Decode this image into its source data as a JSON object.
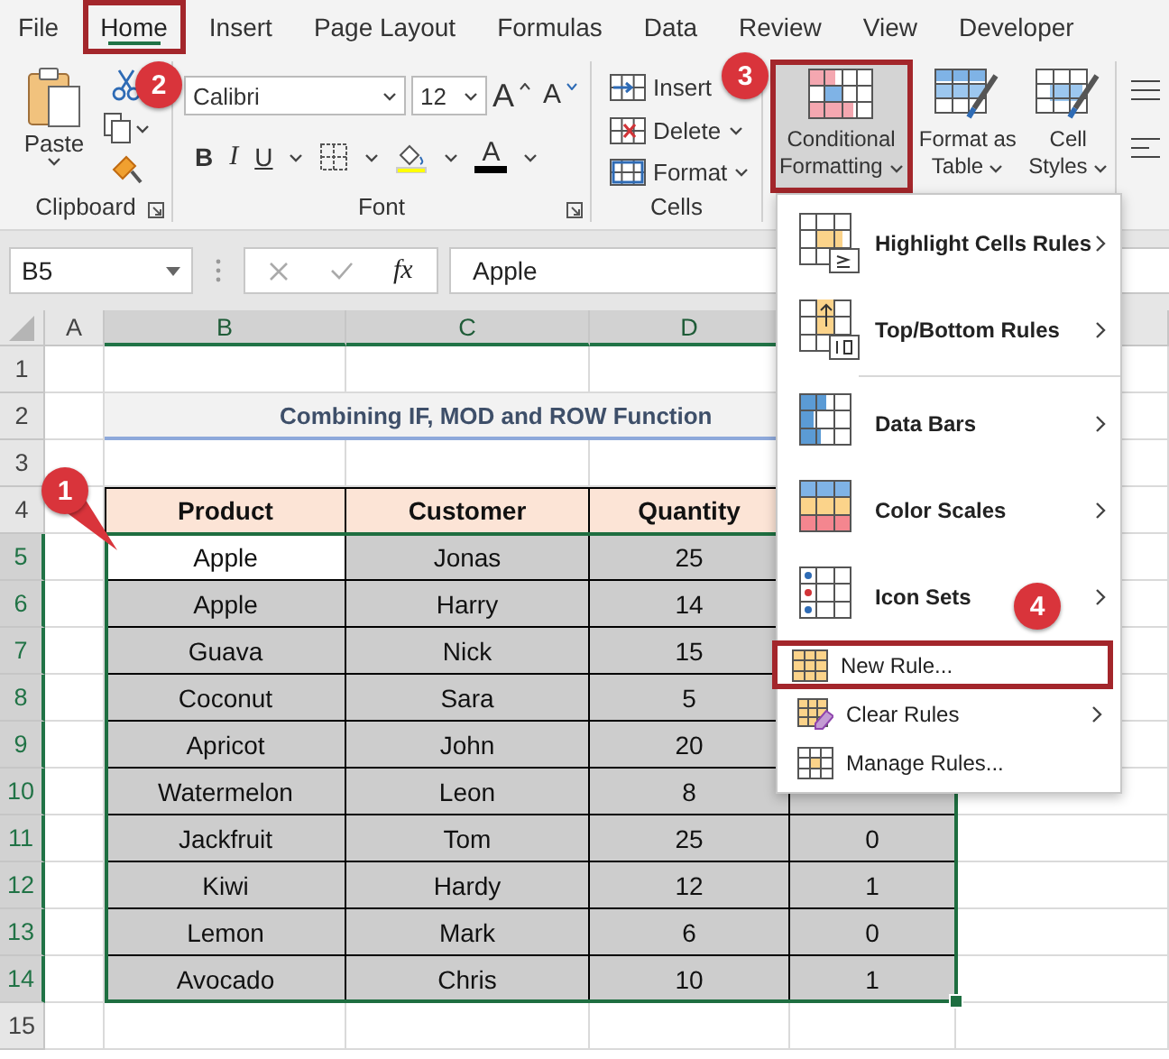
{
  "tabs": [
    {
      "label": "File",
      "selected": false,
      "highlighted": false
    },
    {
      "label": "Home",
      "selected": true,
      "highlighted": true
    },
    {
      "label": "Insert",
      "selected": false,
      "highlighted": false
    },
    {
      "label": "Page Layout",
      "selected": false,
      "highlighted": false
    },
    {
      "label": "Formulas",
      "selected": false,
      "highlighted": false
    },
    {
      "label": "Data",
      "selected": false,
      "highlighted": false
    },
    {
      "label": "Review",
      "selected": false,
      "highlighted": false
    },
    {
      "label": "View",
      "selected": false,
      "highlighted": false
    },
    {
      "label": "Developer",
      "selected": false,
      "highlighted": false
    }
  ],
  "ribbon": {
    "clipboard": {
      "paste_label": "Paste",
      "group_label": "Clipboard"
    },
    "font": {
      "font_name": "Calibri",
      "font_size": "12",
      "grow_label": "A",
      "shrink_label": "A",
      "bold_label": "B",
      "italic_label": "I",
      "underline_label": "U",
      "font_color_label": "A",
      "group_label": "Font"
    },
    "cells": {
      "items": [
        {
          "label": "Insert",
          "dropdown": false
        },
        {
          "label": "Delete",
          "dropdown": true
        },
        {
          "label": "Format",
          "dropdown": true
        }
      ],
      "group_label": "Cells"
    },
    "styles": [
      {
        "label": "Conditional Formatting",
        "pressed": true,
        "highlighted": true
      },
      {
        "label": "Format as Table",
        "pressed": false,
        "highlighted": false
      },
      {
        "label": "Cell Styles",
        "pressed": false,
        "highlighted": false
      }
    ]
  },
  "formula_bar": {
    "name_box": "B5",
    "function_label": "fx",
    "formula": "Apple"
  },
  "sheet": {
    "columns": [
      {
        "label": "A",
        "selected": false
      },
      {
        "label": "B",
        "selected": true
      },
      {
        "label": "C",
        "selected": true
      },
      {
        "label": "D",
        "selected": true
      }
    ],
    "rows": [
      {
        "num": "1",
        "kind": "empty",
        "selected": false
      },
      {
        "num": "2",
        "kind": "title",
        "selected": false,
        "text": "Combining IF, MOD and ROW Function"
      },
      {
        "num": "3",
        "kind": "empty",
        "selected": false
      },
      {
        "num": "4",
        "kind": "header",
        "selected": false,
        "cells": [
          "Product",
          "Customer",
          "Quantity"
        ]
      },
      {
        "num": "5",
        "kind": "data",
        "selected": true,
        "active": true,
        "cells": [
          "Apple",
          "Jonas",
          "25"
        ]
      },
      {
        "num": "6",
        "kind": "data",
        "selected": true,
        "active": false,
        "cells": [
          "Apple",
          "Harry",
          "14"
        ]
      },
      {
        "num": "7",
        "kind": "data",
        "selected": true,
        "active": false,
        "cells": [
          "Guava",
          "Nick",
          "15"
        ]
      },
      {
        "num": "8",
        "kind": "data",
        "selected": true,
        "active": false,
        "cells": [
          "Coconut",
          "Sara",
          "5"
        ]
      },
      {
        "num": "9",
        "kind": "data",
        "selected": true,
        "active": false,
        "cells": [
          "Apricot",
          "John",
          "20"
        ]
      },
      {
        "num": "10",
        "kind": "data",
        "selected": true,
        "active": false,
        "cells": [
          "Watermelon",
          "Leon",
          "8"
        ]
      },
      {
        "num": "11",
        "kind": "data",
        "selected": true,
        "active": false,
        "cells": [
          "Jackfruit",
          "Tom",
          "25",
          "0"
        ]
      },
      {
        "num": "12",
        "kind": "data",
        "selected": true,
        "active": false,
        "cells": [
          "Kiwi",
          "Hardy",
          "12",
          "1"
        ]
      },
      {
        "num": "13",
        "kind": "data",
        "selected": true,
        "active": false,
        "cells": [
          "Lemon",
          "Mark",
          "6",
          "0"
        ]
      },
      {
        "num": "14",
        "kind": "data",
        "selected": true,
        "active": false,
        "cells": [
          "Avocado",
          "Chris",
          "10",
          "1"
        ]
      },
      {
        "num": "15",
        "kind": "empty",
        "selected": false
      }
    ]
  },
  "menu": {
    "items": [
      {
        "kind": "large",
        "label": "Highlight Cells Rules",
        "submenu": true,
        "highlighted": false
      },
      {
        "kind": "large",
        "label": "Top/Bottom Rules",
        "submenu": true,
        "highlighted": false
      },
      {
        "kind": "separator"
      },
      {
        "kind": "large",
        "label": "Data Bars",
        "submenu": true,
        "highlighted": false
      },
      {
        "kind": "large",
        "label": "Color Scales",
        "submenu": true,
        "highlighted": false
      },
      {
        "kind": "large",
        "label": "Icon Sets",
        "submenu": true,
        "highlighted": false
      },
      {
        "kind": "small",
        "label": "New Rule...",
        "submenu": false,
        "highlighted": true
      },
      {
        "kind": "small",
        "label": "Clear Rules",
        "submenu": true,
        "highlighted": false
      },
      {
        "kind": "small",
        "label": "Manage Rules...",
        "submenu": false,
        "highlighted": false
      }
    ]
  },
  "callouts": [
    {
      "label": "1",
      "kind": "pointer"
    },
    {
      "label": "2",
      "kind": "plain"
    },
    {
      "label": "3",
      "kind": "plain"
    },
    {
      "label": "4",
      "kind": "plain"
    }
  ]
}
